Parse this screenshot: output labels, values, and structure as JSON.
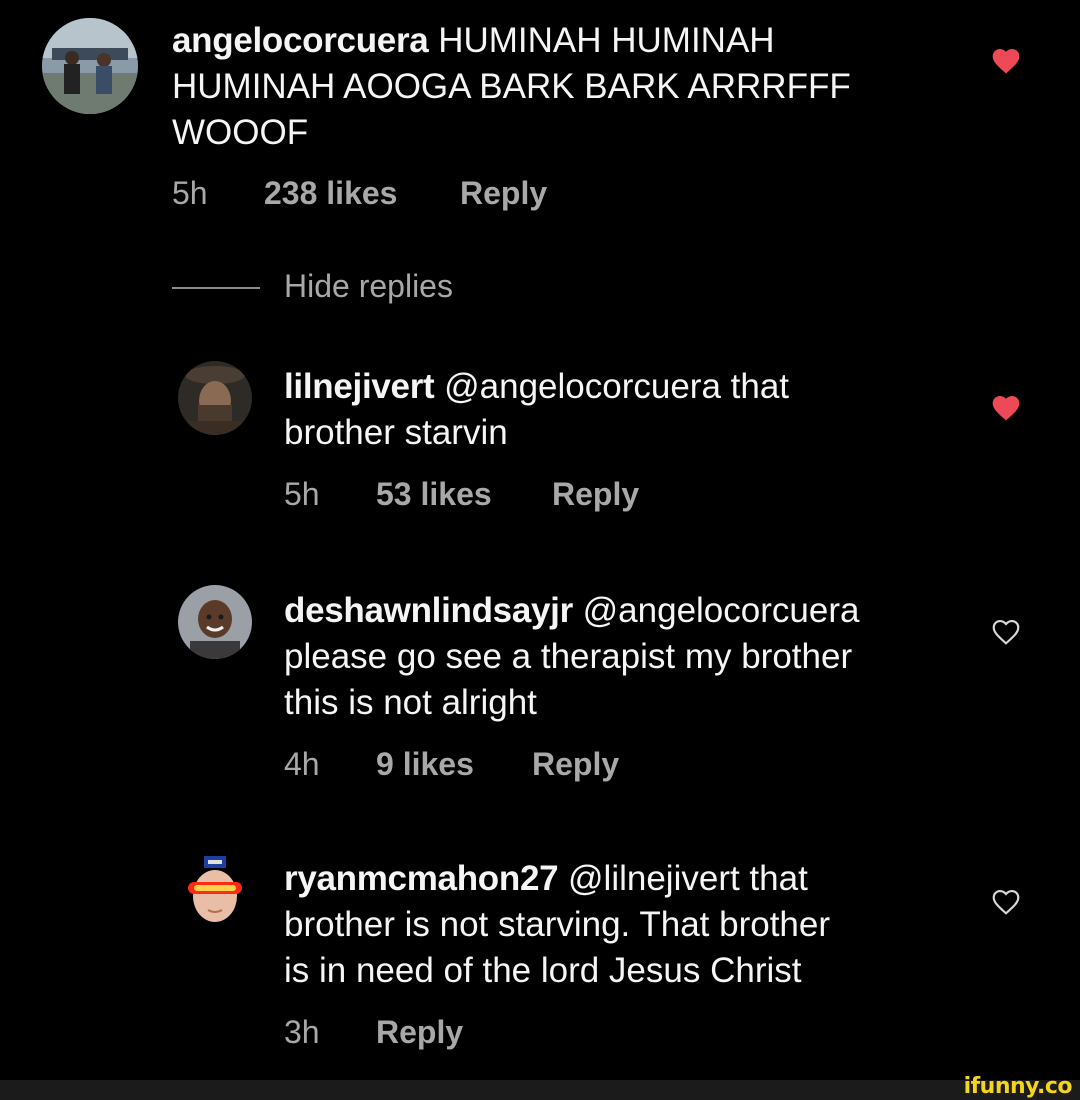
{
  "comments": [
    {
      "username": "angelocorcuera",
      "lines": [
        "HUMINAH HUMINAH",
        "HUMINAH AOOGA BARK BARK ARRRFFF",
        "WOOOF"
      ],
      "time": "5h",
      "likes": "238 likes",
      "reply": "Reply",
      "liked": true
    },
    {
      "username": "lilnejivert",
      "lines": [
        "@angelocorcuera that",
        "brother starvin"
      ],
      "time": "5h",
      "likes": "53 likes",
      "reply": "Reply",
      "liked": true
    },
    {
      "username": "deshawnlindsayjr",
      "lines": [
        "@angelocorcuera",
        "please go see a therapist my brother",
        "this is not alright"
      ],
      "time": "4h",
      "likes": "9 likes",
      "reply": "Reply",
      "liked": false
    },
    {
      "username": "ryanmcmahon27",
      "lines": [
        "@lilnejivert that",
        "brother is not starving. That brother",
        "is in need of the lord Jesus Christ"
      ],
      "time": "3h",
      "likes": "",
      "reply": "Reply",
      "liked": false
    }
  ],
  "hide_replies": "Hide replies",
  "watermark": "ifunny.co",
  "colors": {
    "background": "#000000",
    "text": "#f5f5f5",
    "meta": "#a8a8a8",
    "heart_liked": "#ed4956",
    "watermark": "#f4d51a"
  },
  "icons": {
    "liked": "heart-filled-icon",
    "unliked": "heart-outline-icon"
  }
}
